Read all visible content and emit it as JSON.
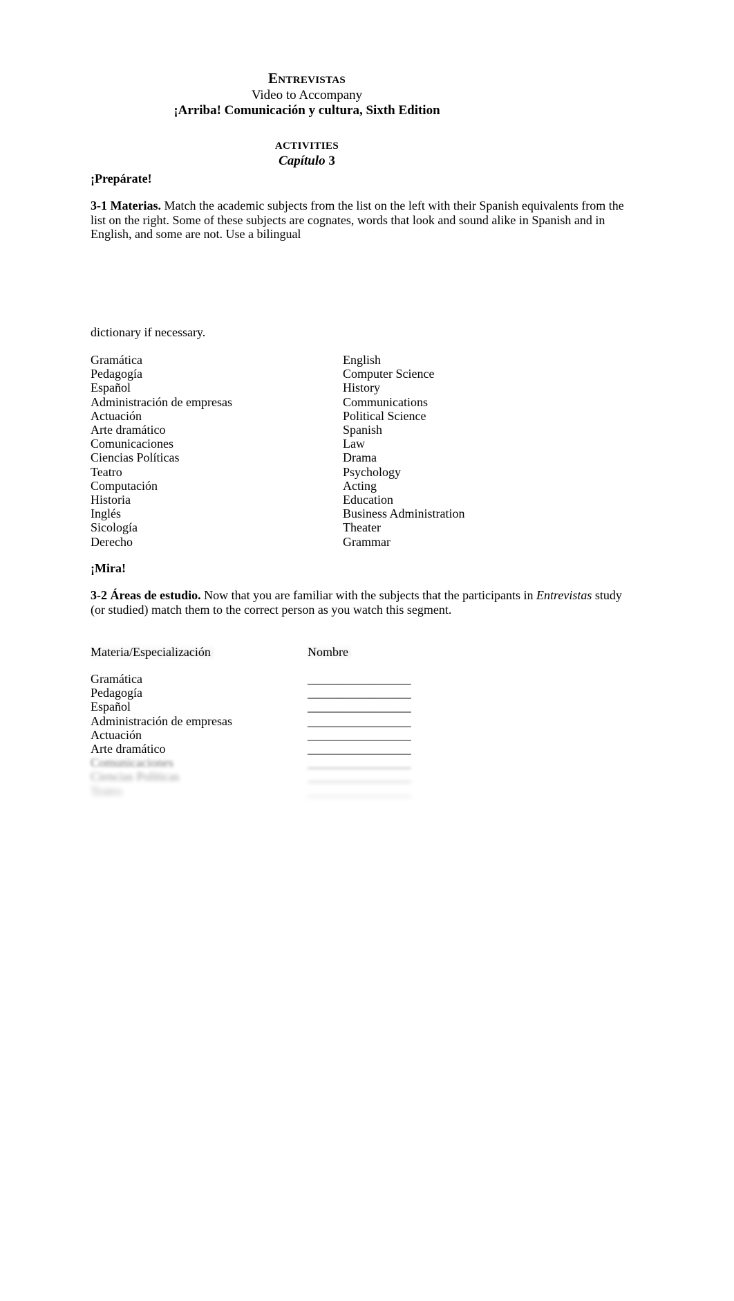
{
  "header": {
    "title": "Entrevistas",
    "subtitle": "Video to Accompany",
    "edition": "¡Arriba! Comunicación y cultura, Sixth Edition",
    "activities_label": "ACTIVITIES",
    "chapter_word": "Capítulo",
    "chapter_number": "3"
  },
  "sections": {
    "prepare_heading": "¡Prepárate!",
    "mira_heading": "¡Mira!"
  },
  "activity_31": {
    "number_label": "3-1 Materias.",
    "instructions": " Match the academic subjects from the list on the left with their Spanish equivalents from the list on the right.  Some of these subjects are cognates, words that look and sound alike in Spanish and in English, and some are not.  Use a bilingual",
    "instructions_tail": "dictionary if necessary.",
    "spanish_terms": [
      "Gramática",
      "Pedagogía",
      "Español",
      "Administración de empresas",
      "Actuación",
      "Arte dramático",
      "Comunicaciones",
      "Ciencias Políticas",
      "Teatro",
      "Computación",
      "Historia",
      "Inglés",
      "Sicología",
      "Derecho"
    ],
    "english_terms": [
      "English",
      "Computer Science",
      "History",
      "Communications",
      "Political Science",
      "Spanish",
      "Law",
      "Drama",
      "Psychology",
      "Acting",
      "Education",
      "Business Administration",
      "Theater",
      "Grammar"
    ]
  },
  "activity_32": {
    "number_label": "3-2 Áreas de estudio.",
    "instructions_part1": " Now that you are familiar with the subjects that the participants in ",
    "instructions_italic": "Entrevistas",
    "instructions_part2": " study (or studied) match them to the correct person as you watch this segment.",
    "column_headers": {
      "subject": "Materia/Especialización",
      "name": "Nombre"
    },
    "answer_line": "_________________",
    "rows": [
      {
        "subject": "Gramática",
        "blur": 0
      },
      {
        "subject": "Pedagogía",
        "blur": 0
      },
      {
        "subject": "Español",
        "blur": 0
      },
      {
        "subject": "Administración de empresas",
        "blur": 0
      },
      {
        "subject": "Actuación",
        "blur": 0
      },
      {
        "subject": "Arte dramático",
        "blur": 0
      },
      {
        "subject": "Comunicaciones",
        "blur": 1
      },
      {
        "subject": "Ciencias Políticas",
        "blur": 2
      },
      {
        "subject": "Teatro",
        "blur": 3
      }
    ]
  }
}
